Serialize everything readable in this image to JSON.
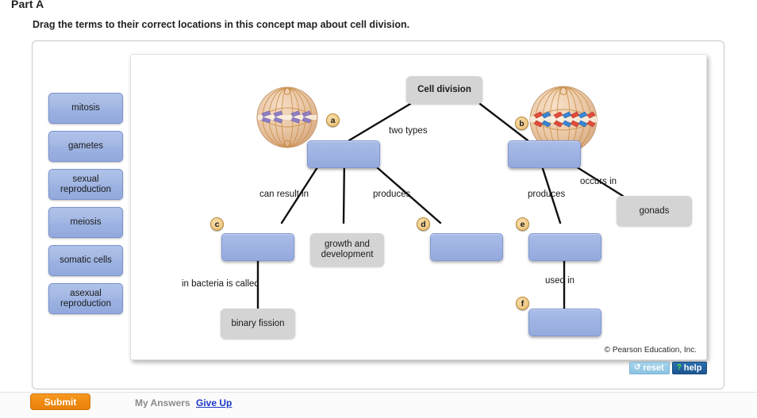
{
  "header": {
    "part_title": "Part A",
    "instructions": "Drag the terms to their correct locations in this concept map about cell division."
  },
  "term_bank": {
    "terms": [
      {
        "id": "mitosis",
        "label": "mitosis"
      },
      {
        "id": "gametes",
        "label": "gametes"
      },
      {
        "id": "sexual-reproduction",
        "label": "sexual\nreproduction"
      },
      {
        "id": "meiosis",
        "label": "meiosis"
      },
      {
        "id": "somatic-cells",
        "label": "somatic cells"
      },
      {
        "id": "asexual-reproduction",
        "label": "asexual\nreproduction"
      }
    ]
  },
  "concept_map": {
    "fixed_nodes": [
      {
        "id": "cell-division",
        "label": "Cell division"
      },
      {
        "id": "growth-and-development",
        "label": "growth and\ndevelopment"
      },
      {
        "id": "binary-fission",
        "label": "binary fission"
      },
      {
        "id": "gonads",
        "label": "gonads"
      }
    ],
    "drop_targets": [
      {
        "letter": "a",
        "label": ""
      },
      {
        "letter": "b",
        "label": ""
      },
      {
        "letter": "c",
        "label": ""
      },
      {
        "letter": "d",
        "label": ""
      },
      {
        "letter": "e",
        "label": ""
      },
      {
        "letter": "f",
        "label": ""
      }
    ],
    "edge_labels": [
      {
        "id": "two-types",
        "text": "two types"
      },
      {
        "id": "can-result-in",
        "text": "can result in"
      },
      {
        "id": "produces-left",
        "text": "produces"
      },
      {
        "id": "produces-right",
        "text": "produces"
      },
      {
        "id": "occurs-in",
        "text": "occurs in"
      },
      {
        "id": "in-bacteria-is-called",
        "text": "in bacteria is called"
      },
      {
        "id": "used-in",
        "text": "used in"
      }
    ],
    "figures": [
      {
        "id": "mitosis-cell-figure",
        "chromosome_color": "#8f7fc4"
      },
      {
        "id": "meiosis-cell-figure",
        "chromosome_color": "#e24b3a"
      }
    ],
    "copyright": "© Pearson Education, Inc."
  },
  "tools": {
    "reset_label": "reset",
    "reset_icon": "↺",
    "help_label": "help",
    "help_icon": "?"
  },
  "footer": {
    "submit_label": "Submit",
    "my_answers_label": "My Answers",
    "give_up_label": "Give Up"
  },
  "colors": {
    "drop_target_blue": "#9fb3e3",
    "fixed_node_gray": "#d4d4d4",
    "badge_tan": "#f2cd8c",
    "submit_orange": "#ef8a10",
    "link_blue": "#1a37c8"
  }
}
